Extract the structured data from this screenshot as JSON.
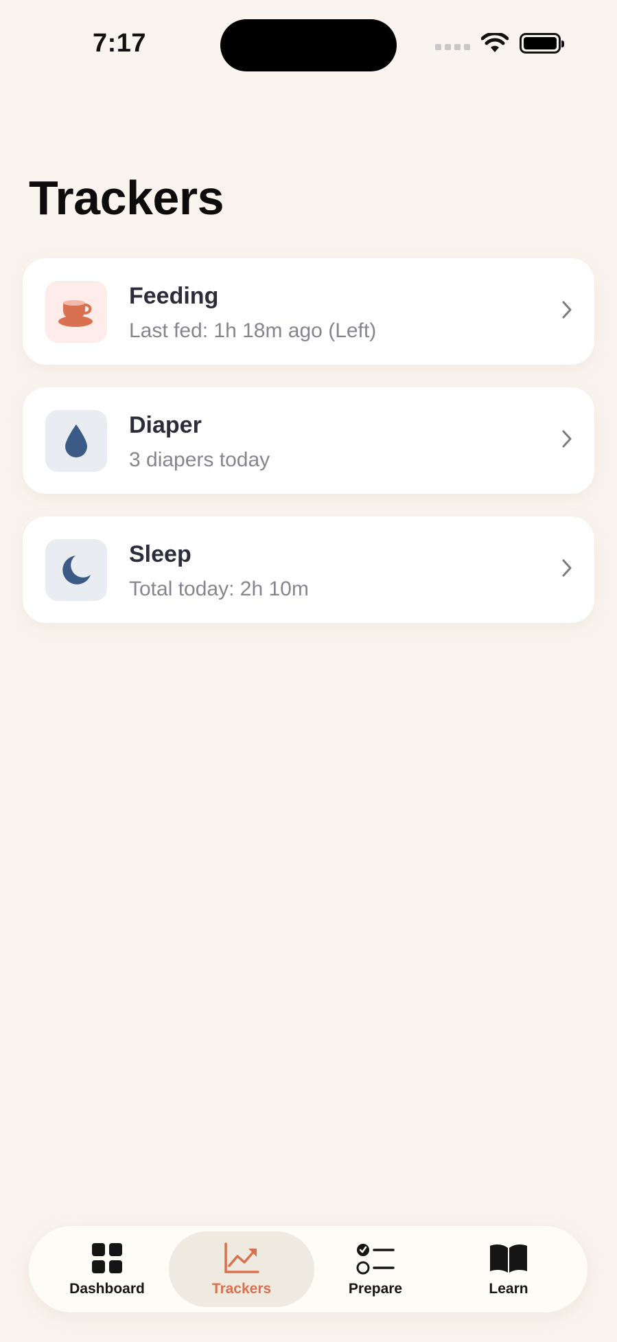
{
  "status_bar": {
    "time": "7:17"
  },
  "page": {
    "title": "Trackers"
  },
  "trackers": [
    {
      "title": "Feeding",
      "subtitle": "Last fed: 1h 18m ago (Left)",
      "icon": "teacup-icon",
      "icon_bg": "#fdecea",
      "icon_color": "#d9704f"
    },
    {
      "title": "Diaper",
      "subtitle": "3 diapers today",
      "icon": "drop-icon",
      "icon_bg": "#e9ecf0",
      "icon_color": "#3c5a86"
    },
    {
      "title": "Sleep",
      "subtitle": "Total today: 2h 10m",
      "icon": "moon-icon",
      "icon_bg": "#e9ecf0",
      "icon_color": "#3c5a86"
    }
  ],
  "tabbar": {
    "items": [
      {
        "label": "Dashboard",
        "icon": "grid-icon"
      },
      {
        "label": "Trackers",
        "icon": "chart-up-icon",
        "active": true
      },
      {
        "label": "Prepare",
        "icon": "checklist-icon"
      },
      {
        "label": "Learn",
        "icon": "book-icon"
      }
    ]
  },
  "colors": {
    "background": "#f9f4ee",
    "accent": "#d9704f",
    "navy": "#3c5a86"
  }
}
